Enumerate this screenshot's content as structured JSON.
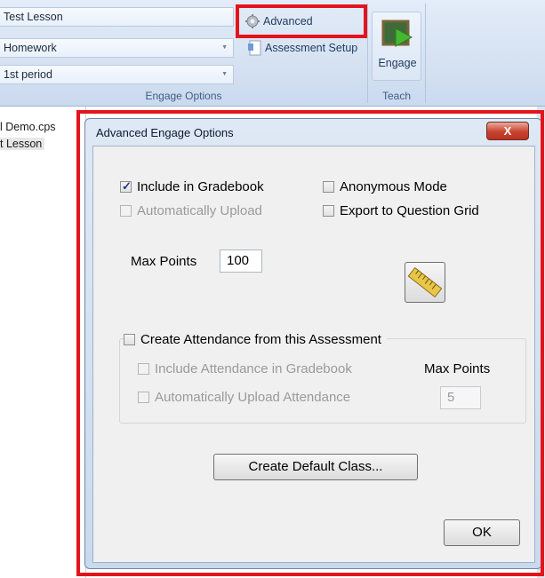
{
  "ribbon": {
    "combos": [
      "Test Lesson",
      "Homework",
      "1st period"
    ],
    "group_label": "Engage Options",
    "advanced_label": "Advanced",
    "assessment_setup_label": "Assessment Setup",
    "engage_label": "Engage",
    "teach_label": "Teach"
  },
  "left_pane": {
    "items": [
      "l Demo.cps",
      "t Lesson"
    ]
  },
  "dialog": {
    "title": "Advanced Engage Options",
    "close_label": "X",
    "include_gradebook": {
      "label": "Include in Gradebook",
      "checked": true
    },
    "auto_upload": {
      "label": "Automatically Upload",
      "checked": false,
      "disabled": true
    },
    "anonymous_mode": {
      "label": "Anonymous Mode",
      "checked": false
    },
    "export_grid": {
      "label": "Export to Question Grid",
      "checked": false
    },
    "max_points": {
      "label": "Max Points",
      "value": "100"
    },
    "attendance": {
      "label": "Create Attendance from this Assessment",
      "include_gradebook": "Include Attendance in Gradebook",
      "auto_upload": "Automatically Upload Attendance",
      "max_points_label": "Max Points",
      "max_points_value": "5"
    },
    "create_default_class": "Create Default Class...",
    "ok": "OK"
  },
  "colors": {
    "highlight": "#e4141b",
    "ribbon_blue": "#d3e0f1",
    "dialog_frame": "#c9daee"
  },
  "icons": [
    "gear-icon",
    "assessment-icon",
    "engage-icon",
    "ruler-icon",
    "close-icon"
  ]
}
